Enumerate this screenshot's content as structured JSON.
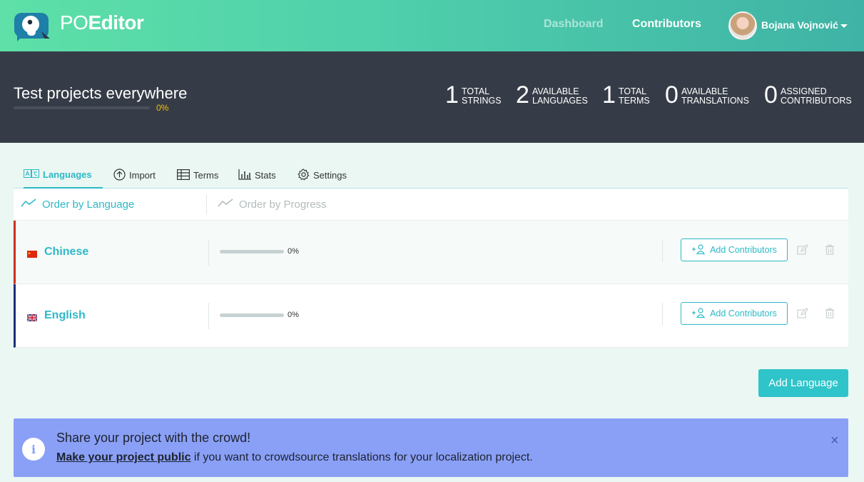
{
  "app": {
    "brand_light": "PO",
    "brand_bold": "Editor",
    "nav": {
      "dashboard": "Dashboard",
      "contributors": "Contributors"
    },
    "user": {
      "name": "Bojana Vojnović"
    }
  },
  "project": {
    "title": "Test projects everywhere",
    "progress_label": "0%",
    "progress_value": 0,
    "stats": [
      {
        "number": "1",
        "label": "TOTAL\nSTRINGS"
      },
      {
        "number": "2",
        "label": "AVAILABLE\nLANGUAGES"
      },
      {
        "number": "1",
        "label": "TOTAL\nTERMS"
      },
      {
        "number": "0",
        "label": "AVAILABLE\nTRANSLATIONS"
      },
      {
        "number": "0",
        "label": "ASSIGNED\nCONTRIBUTORS"
      }
    ]
  },
  "tabs": [
    {
      "label": "Languages",
      "icon": "languages-icon",
      "active": true
    },
    {
      "label": "Import",
      "icon": "import-icon"
    },
    {
      "label": "Terms",
      "icon": "table-icon"
    },
    {
      "label": "Stats",
      "icon": "bar-chart-icon"
    },
    {
      "label": "Settings",
      "icon": "gear-icon"
    }
  ],
  "ordering": {
    "by_language": "Order by Language",
    "by_progress": "Order by Progress"
  },
  "languages": [
    {
      "name": "Chinese",
      "flag": "cn-flag-icon",
      "progress_label": "0%",
      "progress_value": 0,
      "button": "Add Contributors",
      "accent": "#c8321e"
    },
    {
      "name": "English",
      "flag": "uk-flag-icon",
      "progress_label": "0%",
      "progress_value": 0,
      "button": "Add Contributors",
      "accent": "#1b2f7a"
    }
  ],
  "actions": {
    "add_language": "Add Language"
  },
  "banner": {
    "title": "Share your project with the crowd!",
    "link": "Make your project public",
    "text": " if you want to crowdsource translations for your localization project.",
    "close": "×"
  },
  "colors": {
    "accent": "#2db9c7",
    "header_dark": "#363c47",
    "banner": "#8aa0f6",
    "progress_yellow": "#f3c200"
  }
}
